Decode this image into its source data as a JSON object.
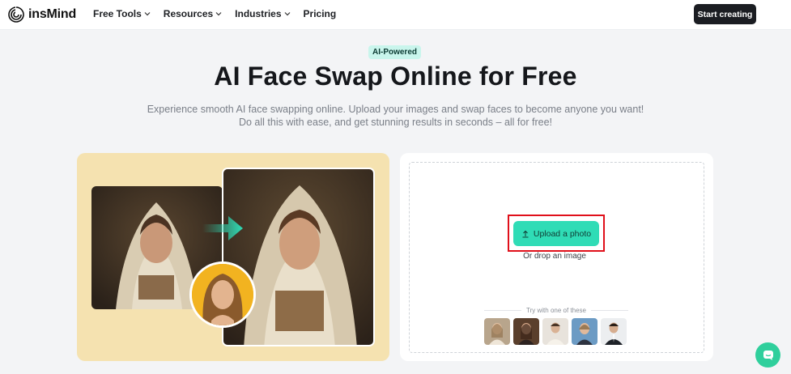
{
  "nav": {
    "brand": "insMind",
    "items": [
      {
        "label": "Free Tools",
        "has_dropdown": true
      },
      {
        "label": "Resources",
        "has_dropdown": true
      },
      {
        "label": "Industries",
        "has_dropdown": true
      },
      {
        "label": "Pricing",
        "has_dropdown": false
      }
    ],
    "cta_label": "Start creating"
  },
  "hero": {
    "badge": "AI-Powered",
    "title": "AI Face Swap Online for Free",
    "subtitle_line1": "Experience smooth AI face swapping online. Upload your images and swap faces to become anyone you want!",
    "subtitle_line2": "Do all this with ease, and get stunning results in seconds – all for free!"
  },
  "upload": {
    "button_label": "Upload a photo",
    "drop_text": "Or drop an image",
    "try_label": "Try with one of these",
    "samples": [
      "sample-1",
      "sample-2",
      "sample-3",
      "sample-4",
      "sample-5"
    ]
  },
  "icons": {
    "logo": "spiral-logo-icon",
    "chevron": "chevron-down-icon",
    "upload": "upload-arrow-icon",
    "arrow": "right-arrow-icon",
    "chat": "chat-bubble-icon"
  },
  "colors": {
    "accent": "#2fdcb6",
    "badge_bg": "#c9f5ec",
    "highlight_border": "#e0101a",
    "cta_bg": "#1b1d22",
    "preview_bg": "#f5e2b0"
  }
}
